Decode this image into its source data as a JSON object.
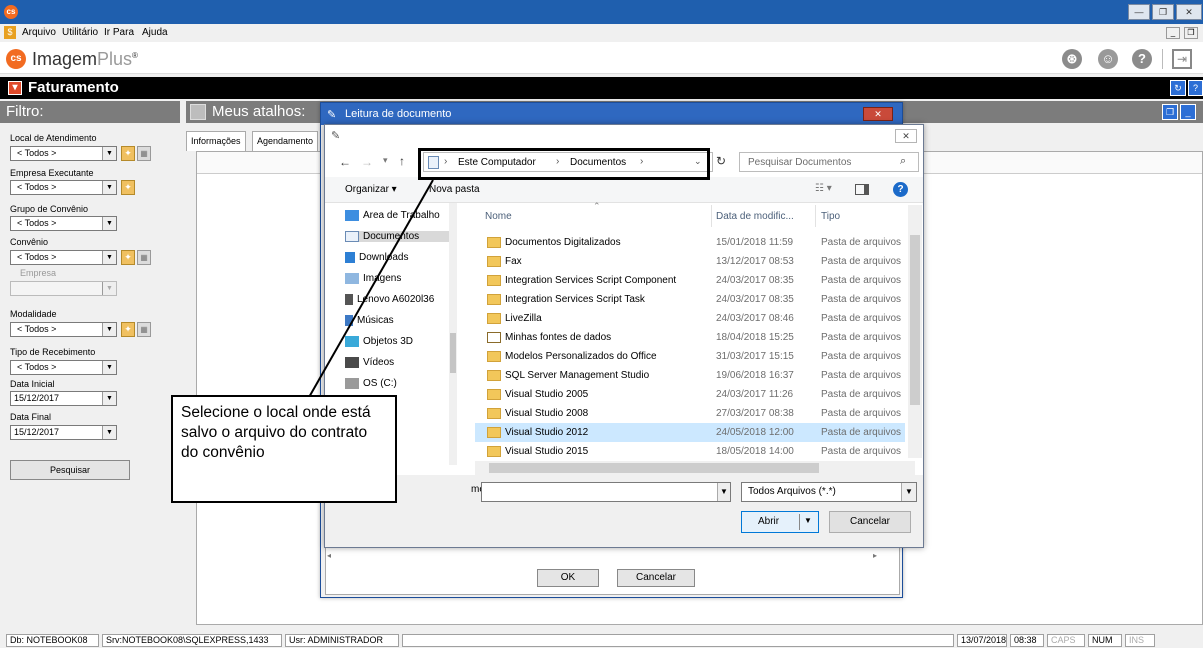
{
  "menu": {
    "items": [
      "Arquivo",
      "Utilitário",
      "Ir Para",
      "Ajuda"
    ]
  },
  "brand": {
    "name_part1": "Imagem",
    "name_part2": "Plus",
    "mark": "®",
    "logo_text": "cs"
  },
  "module": {
    "title": "Faturamento"
  },
  "filter": {
    "title": "Filtro:",
    "fields": {
      "local_label": "Local de Atendimento",
      "local_value": "< Todos >",
      "empresa_label": "Empresa Executante",
      "empresa_value": "< Todos >",
      "grupo_label": "Grupo de Convênio",
      "grupo_value": "< Todos >",
      "convenio_label": "Convênio",
      "convenio_value": "< Todos >",
      "empresa_sub_label": "Empresa",
      "empresa_sub_value": "",
      "modalidade_label": "Modalidade",
      "modalidade_value": "< Todos >",
      "tipo_label": "Tipo de Recebimento",
      "tipo_value": "< Todos >",
      "data_inicial_label": "Data Inicial",
      "data_inicial_value": "15/12/2017",
      "data_final_label": "Data Final",
      "data_final_value": "15/12/2017"
    },
    "search_button": "Pesquisar"
  },
  "shortcuts": {
    "title": "Meus atalhos:",
    "tabs": [
      "Informações",
      "Agendamento"
    ]
  },
  "dialog_outer": {
    "title": "Leitura de documento",
    "ok": "OK",
    "cancel": "Cancelar"
  },
  "dialog_open": {
    "address": [
      "Este Computador",
      "Documentos"
    ],
    "search_placeholder": "Pesquisar Documentos",
    "organize": "Organizar ▾",
    "new_folder": "Nova pasta",
    "nav": [
      "Área de Trabalho",
      "Documentos",
      "Downloads",
      "Imagens",
      "Lenovo A6020l36",
      "Músicas",
      "Objetos 3D",
      "Vídeos",
      "OS (C:)"
    ],
    "columns": {
      "name": "Nome",
      "date": "Data de modific...",
      "type": "Tipo"
    },
    "files": [
      {
        "name": "Documentos Digitalizados",
        "date": "15/01/2018 11:59",
        "type": "Pasta de arquivos"
      },
      {
        "name": "Fax",
        "date": "13/12/2017 08:53",
        "type": "Pasta de arquivos"
      },
      {
        "name": "Integration Services Script Component",
        "date": "24/03/2017 08:35",
        "type": "Pasta de arquivos"
      },
      {
        "name": "Integration Services Script Task",
        "date": "24/03/2017 08:35",
        "type": "Pasta de arquivos"
      },
      {
        "name": "LiveZilla",
        "date": "24/03/2017 08:46",
        "type": "Pasta de arquivos"
      },
      {
        "name": "Minhas fontes de dados",
        "date": "18/04/2018 15:25",
        "type": "Pasta de arquivos"
      },
      {
        "name": "Modelos Personalizados do Office",
        "date": "31/03/2017 15:15",
        "type": "Pasta de arquivos"
      },
      {
        "name": "SQL Server Management Studio",
        "date": "19/06/2018 16:37",
        "type": "Pasta de arquivos"
      },
      {
        "name": "Visual Studio 2005",
        "date": "24/03/2017 11:26",
        "type": "Pasta de arquivos"
      },
      {
        "name": "Visual Studio 2008",
        "date": "27/03/2017 08:38",
        "type": "Pasta de arquivos"
      },
      {
        "name": "Visual Studio 2012",
        "date": "24/05/2018 12:00",
        "type": "Pasta de arquivos"
      },
      {
        "name": "Visual Studio 2015",
        "date": "18/05/2018 14:00",
        "type": "Pasta de arquivos"
      }
    ],
    "filename_label_partial": "me:",
    "filter_value": "Todos Arquivos (*.*)",
    "open": "Abrir",
    "cancel": "Cancelar"
  },
  "callout": {
    "text": "Selecione o local onde está salvo o arquivo do contrato do convênio"
  },
  "status": {
    "db": "Db: NOTEBOOK08",
    "srv": "Srv:NOTEBOOK08\\SQLEXPRESS,1433",
    "usr": "Usr: ADMINISTRADOR",
    "date": "13/07/2018",
    "time": "08:38",
    "caps": "CAPS",
    "num": "NUM",
    "ins": "INS"
  }
}
